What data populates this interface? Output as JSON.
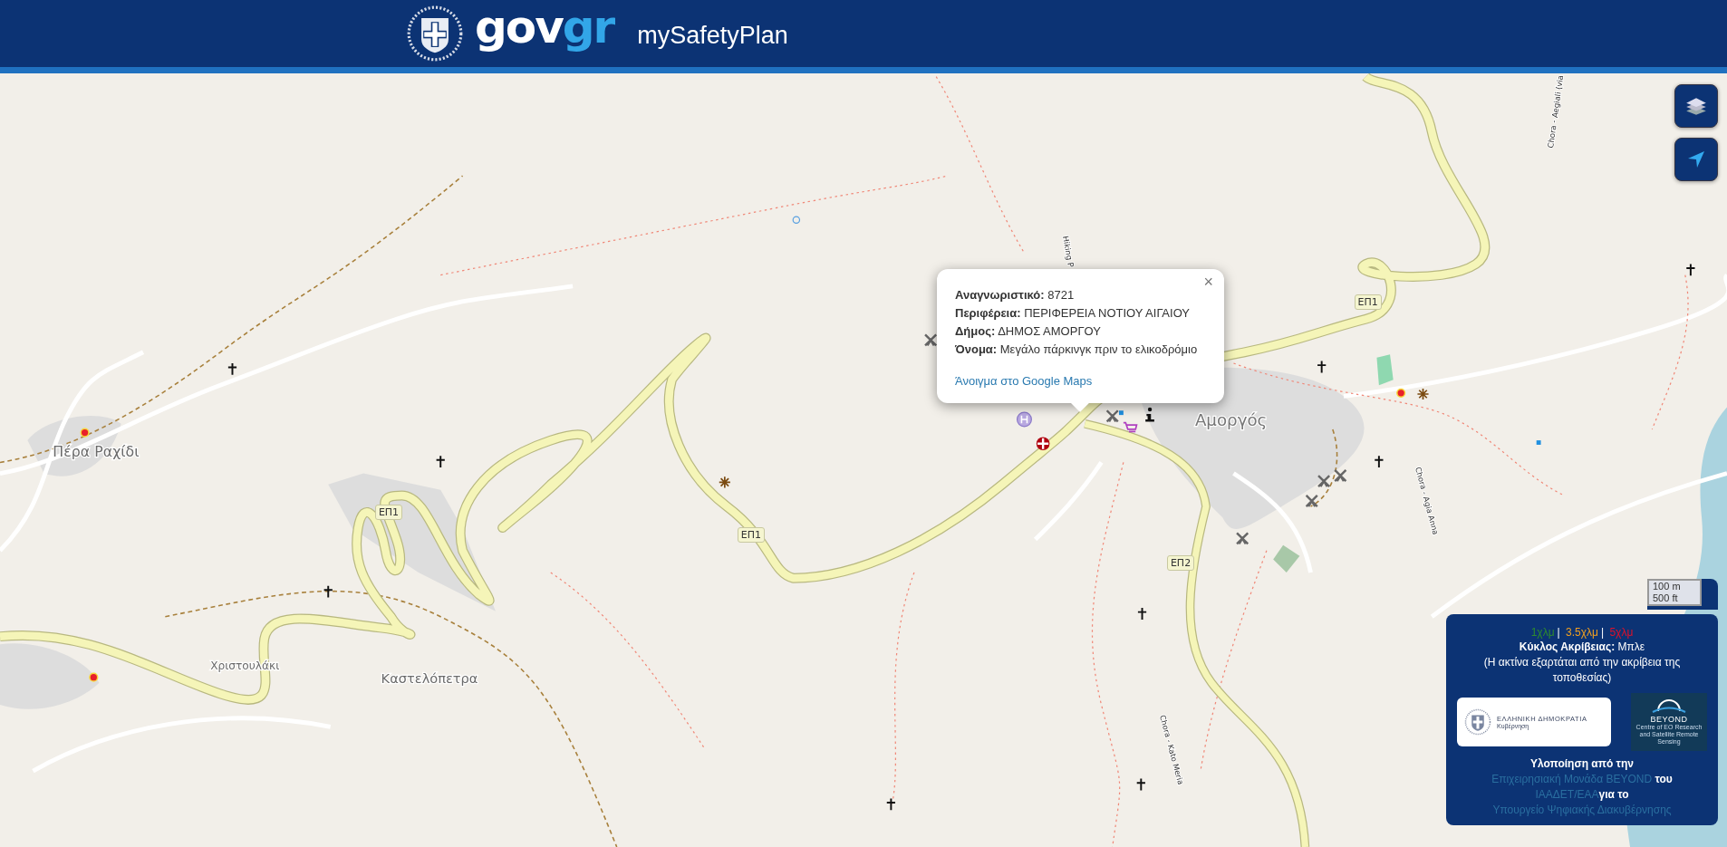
{
  "header": {
    "logo_gov": "gov",
    "logo_gr": "gr",
    "app_title": "mySafetyPlan"
  },
  "map": {
    "place_labels": [
      "Πέρα Ραχίδι",
      "Χριστουλάκι",
      "Καστελόπετρα",
      "Αμοργός"
    ],
    "road_shields": [
      "ΕΠ1",
      "ΕΠ1",
      "ΕΠ1",
      "ΕΠ2"
    ],
    "route_names": [
      "Chora - Aegiali (via",
      "Hiking P",
      "Chora - Agia Anna",
      "Chora - Kato Meria"
    ]
  },
  "popup": {
    "close": "×",
    "fields": [
      {
        "label": "Αναγνωριστικό:",
        "value": "8721"
      },
      {
        "label": "Περιφέρεια:",
        "value": "ΠΕΡΙΦΕΡΕΙΑ ΝΟΤΙΟΥ ΑΙΓΑΙΟΥ"
      },
      {
        "label": "Δήμος:",
        "value": "ΔΗΜΟΣ ΑΜΟΡΓΟΥ"
      },
      {
        "label": "Όνομα:",
        "value": "Μεγάλο πάρκινγκ πριν το ελικοδρόμιο"
      }
    ],
    "link": "Άνοιγμα στο Google Maps"
  },
  "scale": [
    "100 m",
    "500 ft"
  ],
  "legend": {
    "ranges": [
      {
        "label": "1χλμ",
        "color": "#2e8b2e"
      },
      {
        "label": "3.5χλμ",
        "color": "#f0a020"
      },
      {
        "label": "5χλμ",
        "color": "#e0102a"
      }
    ],
    "separator": "|",
    "accuracy": "**Κύκλος Ακρίβειας:** Μπλε",
    "note": "(Η ακτίνα εξαρτάται από την ακρίβεια της τοποθεσίας)"
  },
  "logos": {
    "republic_title": "ΕΛΛΗΝΙΚΗ ΔΗΜΟΚΡΑΤΙΑ",
    "republic_subtitle": "Κυβέρνηση",
    "beyond_name": "BEYOND",
    "beyond_tagline": "Centre of EO Research and Satellite Remote Sensing"
  },
  "credits": [
    {
      "kind": "text",
      "text": "Υλοποίηση από την "
    },
    {
      "kind": "link",
      "text": "Επιχειρησιακή Μονάδα BEYOND"
    },
    {
      "kind": "text",
      "text": " του "
    },
    {
      "kind": "link",
      "text": "ΙΑΑΔΕΤ/ΕΑΑ"
    },
    {
      "kind": "text",
      "text": "για το "
    },
    {
      "kind": "link",
      "text": "Υπουργείο Ψηφιακής Διακυβέρνησης"
    }
  ]
}
